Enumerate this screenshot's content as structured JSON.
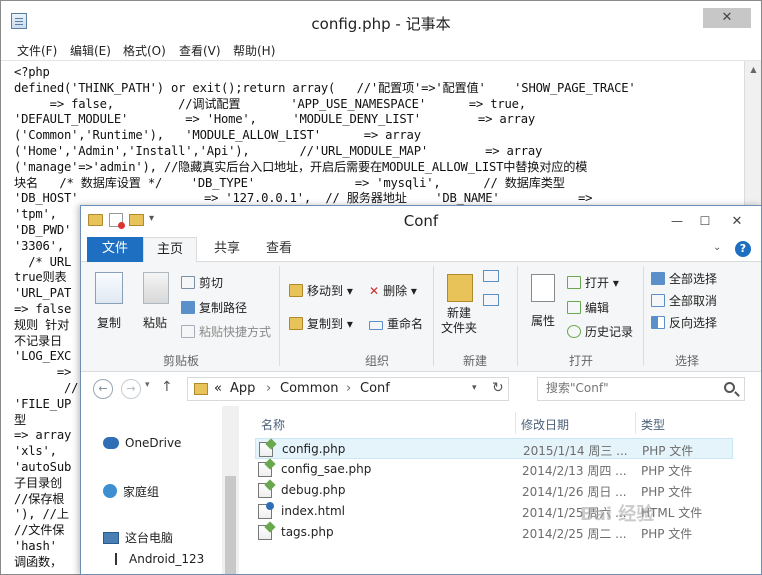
{
  "notepad": {
    "title": "config.php - 记事本",
    "menu": [
      "文件(F)",
      "编辑(E)",
      "格式(O)",
      "查看(V)",
      "帮助(H)"
    ],
    "lines": [
      "<?php",
      "defined('THINK_PATH') or exit();return array(   //'配置项'=>'配置值'    'SHOW_PAGE_TRACE'",
      "     => false,         //调试配置       'APP_USE_NAMESPACE'      => true,",
      "'DEFAULT_MODULE'        => 'Home',     'MODULE_DENY_LIST'        => array",
      "('Common','Runtime'),   'MODULE_ALLOW_LIST'      => array",
      "('Home','Admin','Install','Api'),       //'URL_MODULE_MAP'        => array",
      "('manage'=>'admin'), //隐藏真实后台入口地址，开启后需要在MODULE_ALLOW_LIST中替换对应的模",
      "块名   /* 数据库设置 */    'DB_TYPE'              => 'mysqli',      // 数据库类型",
      "'DB_HOST'",
      "'tpm',",
      "'DB_PWD'",
      "'3306',",
      "  /* URL",
      "true则表",
      "'URL_PAT",
      "=> false",
      "规则 针对",
      "不记录日",
      "'LOG_EXC",
      "      =>",
      "       //",
      "'FILE_UP",
      "型",
      "=> array",
      "'xls',",
      "'autoSub",
      "子目录创",
      "//保存根",
      "'), //上",
      "//文件保",
      "'hash'",
      "调函数，"
    ],
    "line9_right": "=> '127.0.0.1',  // 服务器地址    'DB_NAME'           =>"
  },
  "explorer": {
    "title": "Conf",
    "tabs": {
      "file": "文件",
      "home": "主页",
      "share": "共享",
      "view": "查看"
    },
    "help": "?",
    "ribbon": {
      "clipboard": {
        "label": "剪贴板",
        "copy": "复制",
        "paste": "粘贴",
        "cut": "剪切",
        "copy_path": "复制路径",
        "paste_shortcut": "粘贴快捷方式"
      },
      "organize": {
        "label": "组织",
        "move_to": "移动到",
        "copy_to": "复制到",
        "delete": "删除",
        "rename": "重命名"
      },
      "new": {
        "label": "新建",
        "new_folder": "新建\n文件夹"
      },
      "open": {
        "label": "打开",
        "properties": "属性",
        "open": "打开",
        "edit": "编辑",
        "history": "历史记录"
      },
      "select": {
        "label": "选择",
        "select_all": "全部选择",
        "select_none": "全部取消",
        "invert": "反向选择"
      }
    },
    "address": {
      "prefix": "«",
      "crumbs": [
        "App",
        "Common",
        "Conf"
      ],
      "sep": "›"
    },
    "search": {
      "placeholder": "搜索\"Conf\""
    },
    "nav": {
      "onedrive": "OneDrive",
      "homegroup": "家庭组",
      "this_pc": "这台电脑",
      "android": "Android_123"
    },
    "columns": {
      "name": "名称",
      "date": "修改日期",
      "type": "类型"
    },
    "files": [
      {
        "name": "config.php",
        "date": "2015/1/14 周三 ...",
        "type": "PHP 文件",
        "kind": "php"
      },
      {
        "name": "config_sae.php",
        "date": "2014/2/13 周四 ...",
        "type": "PHP 文件",
        "kind": "php"
      },
      {
        "name": "debug.php",
        "date": "2014/1/26 周日 ...",
        "type": "PHP 文件",
        "kind": "php"
      },
      {
        "name": "index.html",
        "date": "2014/1/25 周六 ...",
        "type": "HTML 文件",
        "kind": "html"
      },
      {
        "name": "tags.php",
        "date": "2014/2/25 周二 ...",
        "type": "PHP 文件",
        "kind": "php"
      }
    ]
  },
  "watermark": "Bai 经验"
}
